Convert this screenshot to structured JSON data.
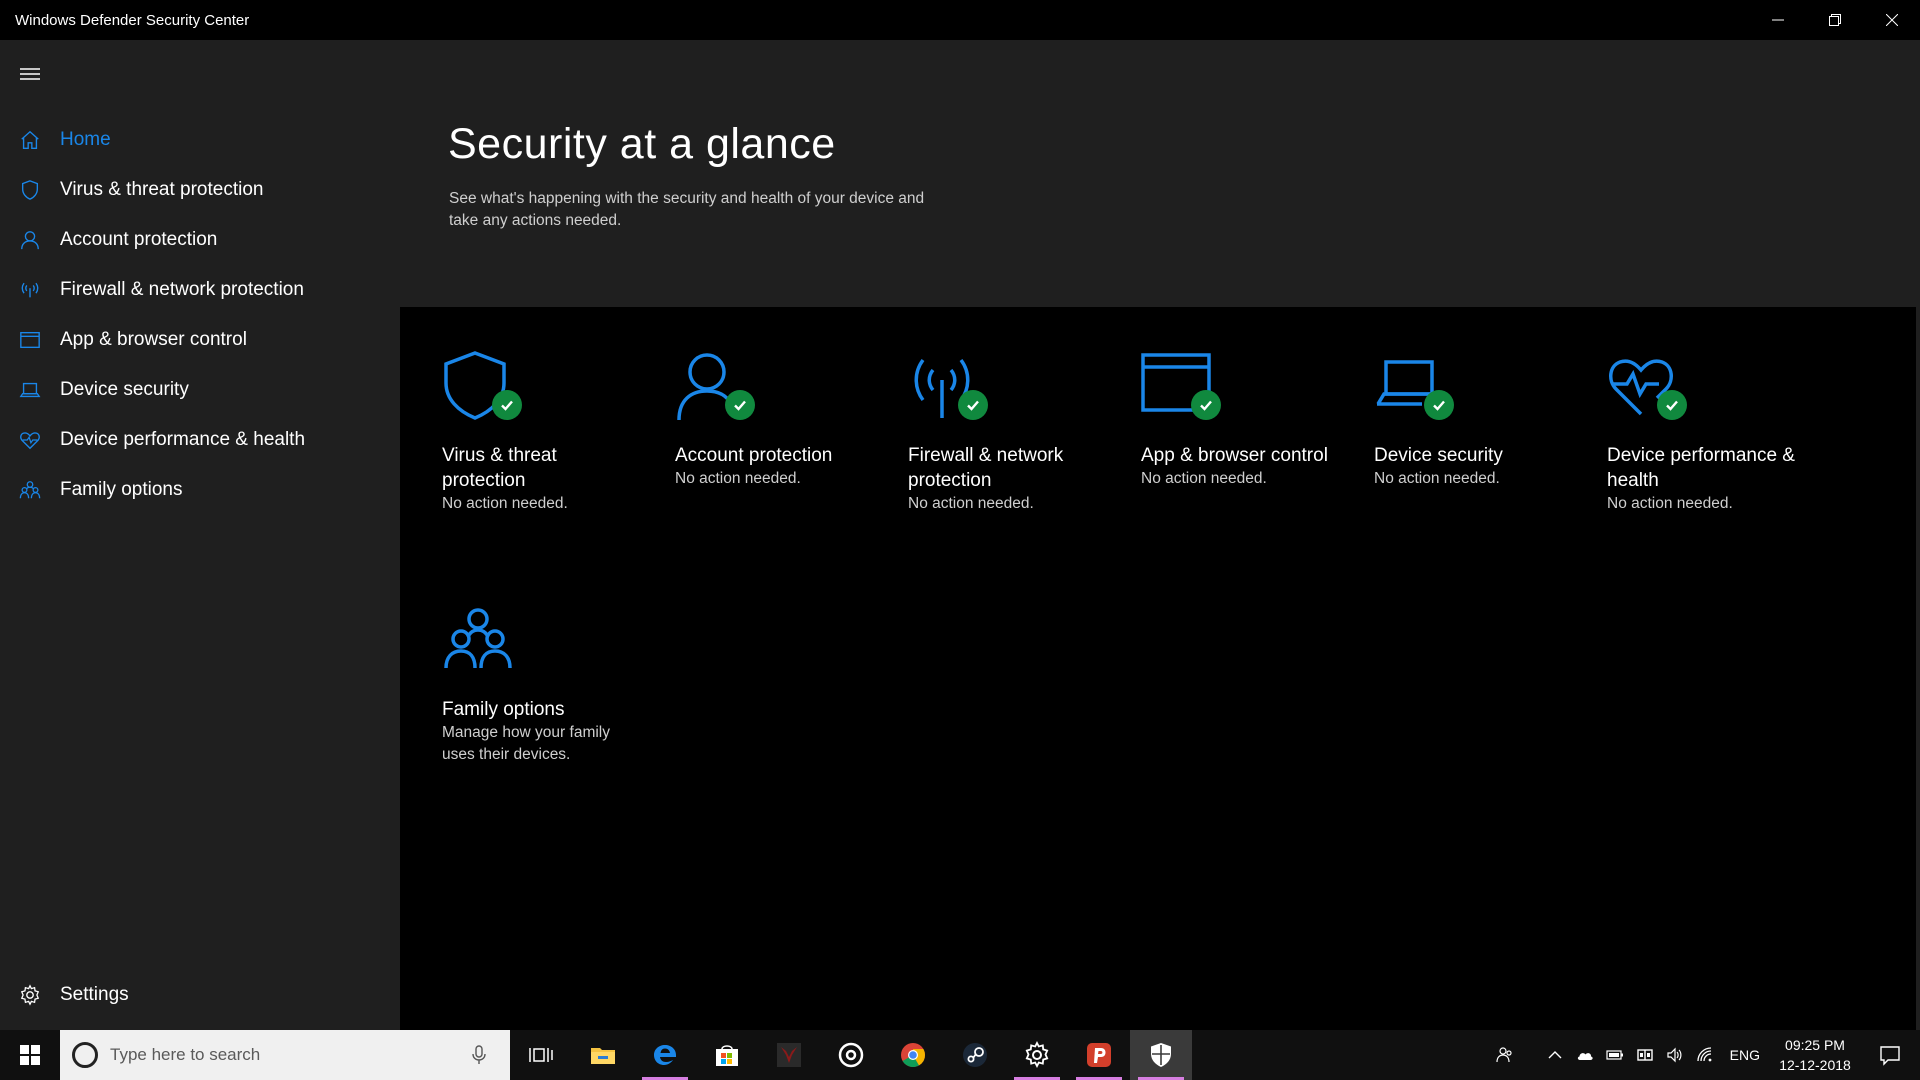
{
  "window": {
    "title": "Windows Defender Security Center"
  },
  "sidebar": {
    "items": [
      {
        "label": "Home",
        "icon": "home-icon",
        "active": true
      },
      {
        "label": "Virus & threat protection",
        "icon": "shield-icon"
      },
      {
        "label": "Account protection",
        "icon": "person-icon"
      },
      {
        "label": "Firewall & network protection",
        "icon": "antenna-icon"
      },
      {
        "label": "App & browser control",
        "icon": "browser-window-icon"
      },
      {
        "label": "Device security",
        "icon": "laptop-icon"
      },
      {
        "label": "Device performance & health",
        "icon": "heart-icon"
      },
      {
        "label": "Family options",
        "icon": "family-icon"
      }
    ],
    "settings_label": "Settings"
  },
  "header": {
    "title": "Security at a glance",
    "subtitle": "See what's happening with the security and health of your device and take any actions needed."
  },
  "tiles": [
    {
      "title": "Virus & threat protection",
      "status": "No action needed.",
      "icon": "shield-icon"
    },
    {
      "title": "Account protection",
      "status": "No action needed.",
      "icon": "person-icon"
    },
    {
      "title": "Firewall & network protection",
      "status": "No action needed.",
      "icon": "antenna-icon"
    },
    {
      "title": "App & browser control",
      "status": "No action needed.",
      "icon": "browser-window-icon"
    },
    {
      "title": "Device security",
      "status": "No action needed.",
      "icon": "laptop-icon"
    },
    {
      "title": "Device performance & health",
      "status": "No action needed.",
      "icon": "heart-icon"
    },
    {
      "title": "Family options",
      "status": "Manage how your family uses their devices.",
      "icon": "family-icon"
    }
  ],
  "taskbar": {
    "search_placeholder": "Type here to search",
    "tray_language": "ENG",
    "clock_time": "09:25 PM",
    "clock_date": "12-12-2018"
  },
  "colors": {
    "accent": "#1a86e8",
    "check_green": "#10893e",
    "sidebar_bg": "#1f1f1f",
    "main_bg": "#000000"
  }
}
